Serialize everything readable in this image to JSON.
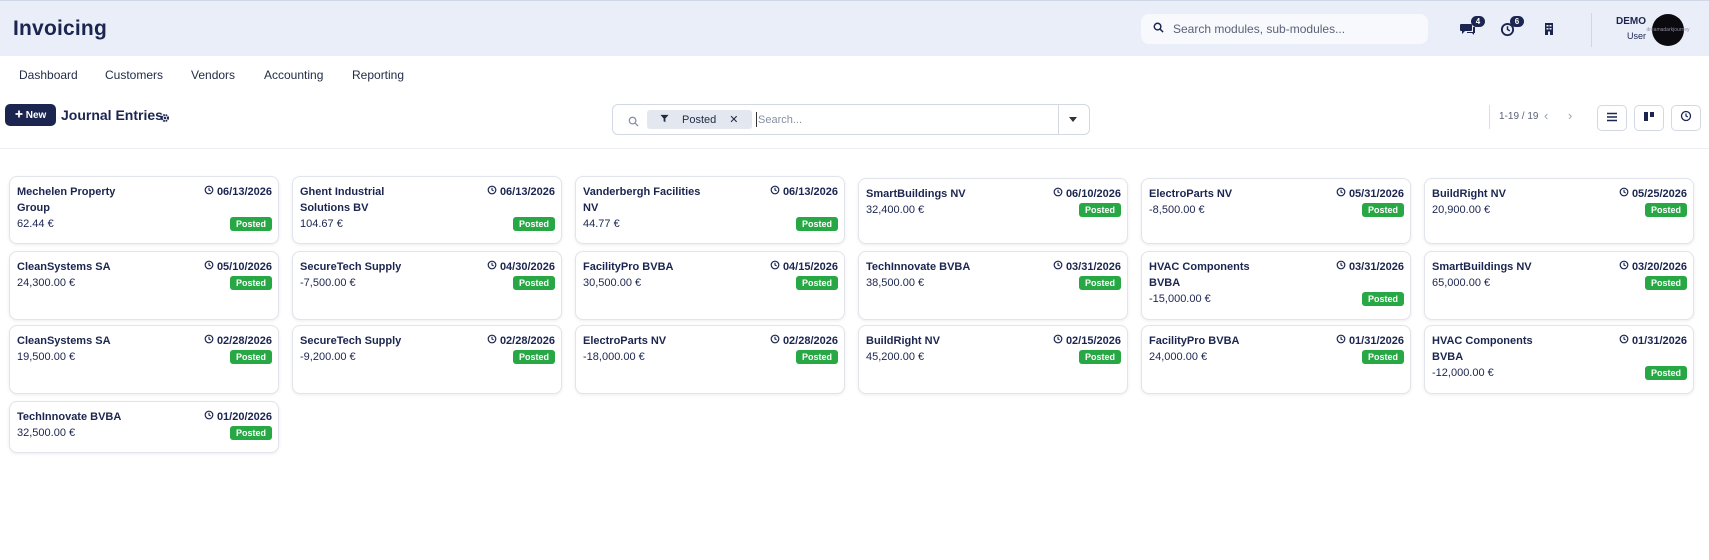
{
  "app": {
    "title": "Invoicing"
  },
  "global_search": {
    "placeholder": "Search modules, sub-modules..."
  },
  "header_icons": [
    {
      "icon": "chat-icon",
      "badge": "4"
    },
    {
      "icon": "activity-clock-icon",
      "badge": "6"
    },
    {
      "icon": "building-icon",
      "badge": ""
    }
  ],
  "user": {
    "name": "DEMO",
    "role": "User",
    "avatar_text": "dreamadarkjourney"
  },
  "nav": [
    "Dashboard",
    "Customers",
    "Vendors",
    "Accounting",
    "Reporting"
  ],
  "toolbar": {
    "new_label": "New",
    "page_title": "Journal Entries"
  },
  "search": {
    "facet_label": "Posted",
    "placeholder": "Search..."
  },
  "pager": {
    "range": "1-19 / 19"
  },
  "colors": {
    "brand": "#1b2550",
    "header_bg": "#e9eef8",
    "posted_green": "#28a745"
  },
  "cards": [
    {
      "name": "Mechelen Property Group",
      "date": "06/13/2026",
      "amount": "62.44 €",
      "status": "Posted"
    },
    {
      "name": "Ghent Industrial Solutions BV",
      "date": "06/13/2026",
      "amount": "104.67 €",
      "status": "Posted"
    },
    {
      "name": "Vanderbergh Facilities NV",
      "date": "06/13/2026",
      "amount": "44.77 €",
      "status": "Posted"
    },
    {
      "name": "SmartBuildings NV",
      "date": "06/10/2026",
      "amount": "32,400.00 €",
      "status": "Posted"
    },
    {
      "name": "ElectroParts NV",
      "date": "05/31/2026",
      "amount": "-8,500.00 €",
      "status": "Posted"
    },
    {
      "name": "BuildRight NV",
      "date": "05/25/2026",
      "amount": "20,900.00 €",
      "status": "Posted"
    },
    {
      "name": "CleanSystems SA",
      "date": "05/10/2026",
      "amount": "24,300.00 €",
      "status": "Posted"
    },
    {
      "name": "SecureTech Supply",
      "date": "04/30/2026",
      "amount": "-7,500.00 €",
      "status": "Posted"
    },
    {
      "name": "FacilityPro BVBA",
      "date": "04/15/2026",
      "amount": "30,500.00 €",
      "status": "Posted"
    },
    {
      "name": "TechInnovate BVBA",
      "date": "03/31/2026",
      "amount": "38,500.00 €",
      "status": "Posted"
    },
    {
      "name": "HVAC Components BVBA",
      "date": "03/31/2026",
      "amount": "-15,000.00 €",
      "status": "Posted"
    },
    {
      "name": "SmartBuildings NV",
      "date": "03/20/2026",
      "amount": "65,000.00 €",
      "status": "Posted"
    },
    {
      "name": "CleanSystems SA",
      "date": "02/28/2026",
      "amount": "19,500.00 €",
      "status": "Posted"
    },
    {
      "name": "SecureTech Supply",
      "date": "02/28/2026",
      "amount": "-9,200.00 €",
      "status": "Posted"
    },
    {
      "name": "ElectroParts NV",
      "date": "02/28/2026",
      "amount": "-18,000.00 €",
      "status": "Posted"
    },
    {
      "name": "BuildRight NV",
      "date": "02/15/2026",
      "amount": "45,200.00 €",
      "status": "Posted"
    },
    {
      "name": "FacilityPro BVBA",
      "date": "01/31/2026",
      "amount": "24,000.00 €",
      "status": "Posted"
    },
    {
      "name": "HVAC Components BVBA",
      "date": "01/31/2026",
      "amount": "-12,000.00 €",
      "status": "Posted"
    },
    {
      "name": "TechInnovate BVBA",
      "date": "01/20/2026",
      "amount": "32,500.00 €",
      "status": "Posted"
    }
  ]
}
